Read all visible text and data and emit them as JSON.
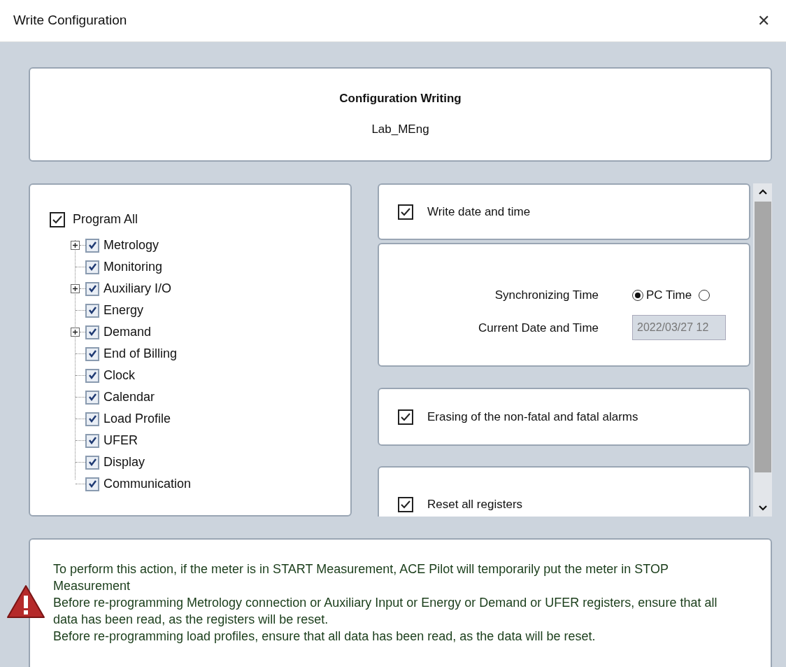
{
  "window": {
    "title": "Write Configuration",
    "close": "✕"
  },
  "header": {
    "title": "Configuration Writing",
    "subtitle": "Lab_MEng"
  },
  "program_all": {
    "label": "Program All",
    "checked": true
  },
  "tree": [
    {
      "label": "Metrology",
      "kind": "group",
      "checked": true
    },
    {
      "label": "Monitoring",
      "kind": "leaf",
      "checked": true
    },
    {
      "label": "Auxiliary I/O",
      "kind": "group",
      "checked": true
    },
    {
      "label": "Energy",
      "kind": "leaf",
      "checked": true
    },
    {
      "label": "Demand",
      "kind": "group",
      "checked": true
    },
    {
      "label": "End of Billing",
      "kind": "leaf",
      "checked": true
    },
    {
      "label": "Clock",
      "kind": "leaf",
      "checked": true
    },
    {
      "label": "Calendar",
      "kind": "leaf",
      "checked": true
    },
    {
      "label": "Load Profile",
      "kind": "leaf",
      "checked": true
    },
    {
      "label": "UFER",
      "kind": "leaf",
      "checked": true
    },
    {
      "label": "Display",
      "kind": "leaf",
      "checked": true
    },
    {
      "label": "Communication",
      "kind": "leaf",
      "checked": true
    }
  ],
  "options": {
    "write_date_time": {
      "label": "Write date and time",
      "checked": true
    },
    "sync": {
      "label": "Synchronizing Time",
      "radios": [
        {
          "label": "PC Time",
          "selected": true
        },
        {
          "selected": false
        }
      ]
    },
    "current": {
      "label": "Current Date and Time",
      "value": "2022/03/27 12",
      "disabled": true
    },
    "erase_alarms": {
      "label": "Erasing of the non-fatal and fatal alarms",
      "checked": true
    },
    "reset_registers": {
      "label": "Reset all registers",
      "checked": true
    }
  },
  "warning": {
    "lines": [
      "To perform this action, if the meter is in START Measurement, ACE Pilot will temporarily put the meter in STOP Measurement",
      "Before re-programming Metrology connection or Auxiliary Input or Energy or Demand or UFER registers, ensure that all data has been read, as the registers will be reset.",
      "Before re-programming load profiles, ensure that all data has been read, as the data will be reset."
    ]
  }
}
